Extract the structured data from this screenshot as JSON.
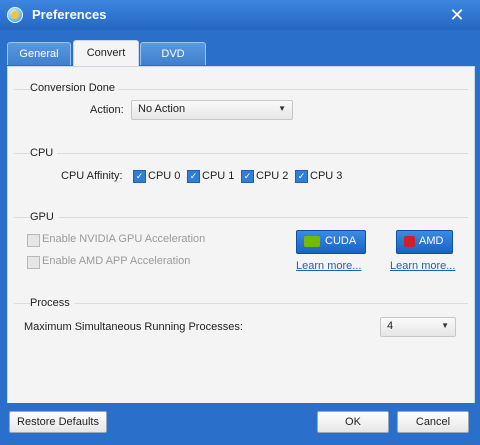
{
  "window": {
    "title": "Preferences",
    "close_glyph": "✕"
  },
  "tabs": [
    {
      "label": "General",
      "active": false
    },
    {
      "label": "Convert",
      "active": true
    },
    {
      "label": "DVD",
      "active": false
    }
  ],
  "conversion": {
    "section": "Conversion Done",
    "action_label": "Action:",
    "action_value": "No Action"
  },
  "cpu": {
    "section": "CPU",
    "affinity_label": "CPU Affinity:",
    "cores": [
      {
        "label": "CPU 0",
        "checked": true
      },
      {
        "label": "CPU 1",
        "checked": true
      },
      {
        "label": "CPU 2",
        "checked": true
      },
      {
        "label": "CPU 3",
        "checked": true
      }
    ]
  },
  "gpu": {
    "section": "GPU",
    "nvidia_label": "Enable NVIDIA GPU Acceleration",
    "amd_label": "Enable AMD APP Acceleration",
    "cuda_button": "CUDA",
    "amd_button": "AMD",
    "learn_more": "Learn more...",
    "learn_more_amd": "Learn more..."
  },
  "process": {
    "section": "Process",
    "max_label": "Maximum Simultaneous Running Processes:",
    "max_value": "4"
  },
  "footer": {
    "restore": "Restore Defaults",
    "ok": "OK",
    "cancel": "Cancel"
  },
  "colors": {
    "titlebar": "#2a6fc9",
    "panel": "#f4f4f4",
    "link": "#1b5fbf",
    "nvidia_green": "#76b900",
    "amd_red": "#d21e2b"
  }
}
